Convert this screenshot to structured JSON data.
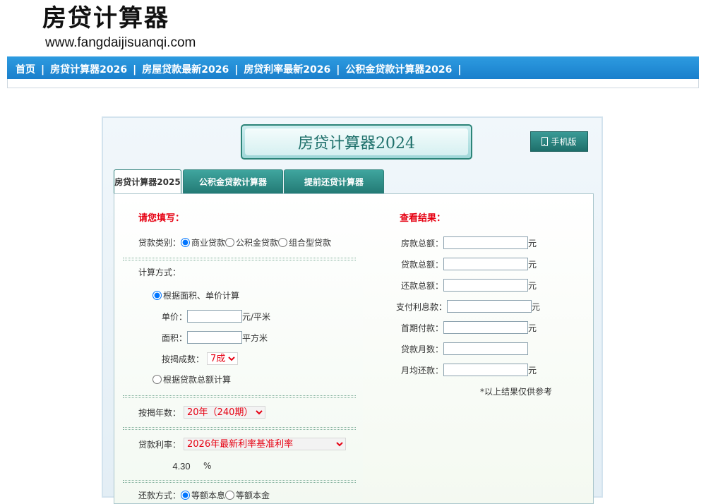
{
  "header": {
    "logo_text": "房贷计算器",
    "logo_url": "www.fangdaijisuanqi.com"
  },
  "nav": {
    "items": [
      "首页",
      "房贷计算器2026",
      "房屋贷款最新2026",
      "房贷利率最新2026",
      "公积金贷款计算器2026"
    ],
    "separator": "|"
  },
  "calculator": {
    "banner_title": "房贷计算器2024",
    "mobile_button": "手机版",
    "tabs": [
      "房贷计算器2025",
      "公积金贷款计算器",
      "提前还贷计算器"
    ],
    "form": {
      "title": "请您填写：",
      "loan_type_label": "贷款类别：",
      "loan_types": [
        "商业贷款",
        "公积金贷款",
        "组合型贷款"
      ],
      "calc_method_label": "计算方式：",
      "method_area": "根据面积、单价计算",
      "unit_price_label": "单价：",
      "unit_price_unit": "元/平米",
      "area_label": "面积：",
      "area_unit": "平方米",
      "ratio_label": "按揭成数：",
      "ratio_value": "7成",
      "method_total": "根据贷款总额计算",
      "years_label": "按揭年数：",
      "years_value": "20年（240期）",
      "rate_label": "贷款利率：",
      "rate_select": "2026年最新利率基准利率",
      "rate_value": "4.30",
      "rate_unit": "%",
      "repay_label": "还款方式：",
      "repay_options": [
        "等额本息",
        "等额本金"
      ]
    },
    "results": {
      "title": "查看结果：",
      "items": [
        {
          "label": "房款总额：",
          "unit": "元"
        },
        {
          "label": "贷款总额：",
          "unit": "元"
        },
        {
          "label": "还款总额：",
          "unit": "元"
        },
        {
          "label": "支付利息款：",
          "unit": "元"
        },
        {
          "label": "首期付款：",
          "unit": "元"
        },
        {
          "label": "贷款月数：",
          "unit": ""
        },
        {
          "label": "月均还款：",
          "unit": "元"
        }
      ],
      "note": "*以上结果仅供参考"
    }
  }
}
